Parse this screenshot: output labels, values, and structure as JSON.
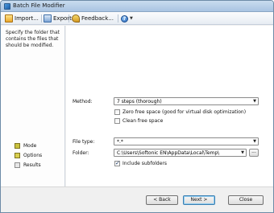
{
  "window": {
    "title": "Batch File Modifier",
    "app_icon": "batch-file-modifier-icon"
  },
  "toolbar": {
    "import_label": "Import...",
    "export_label": "Export...",
    "feedback_label": "Feedback...",
    "help_icon": "help-icon"
  },
  "sidebar": {
    "description": "Specify the folder that contains the files that should be modified.",
    "steps": [
      {
        "label": "Mode",
        "state": "done",
        "color": "#c9c23e"
      },
      {
        "label": "Options",
        "state": "active",
        "color": "#d8cf4e"
      },
      {
        "label": "Results",
        "state": "todo",
        "color": "#e7e7e7"
      }
    ]
  },
  "options": {
    "method_label": "Method:",
    "method_value": "7 steps (thorough)",
    "zero_free_space_label": "Zero free space (good for virtual disk optimization)",
    "zero_free_space_checked": false,
    "clean_free_space_label": "Clean free space",
    "clean_free_space_checked": false,
    "file_type_label": "File type:",
    "file_type_value": "*.*",
    "folder_label": "Folder:",
    "folder_value": "C:\\Users\\Softonic EN\\AppData\\Local\\Temp\\",
    "browse_label": "...",
    "include_subfolders_label": "Include subfolders",
    "include_subfolders_checked": true
  },
  "footer": {
    "back_label": "< Back",
    "next_label": "Next >",
    "close_label": "Close"
  }
}
